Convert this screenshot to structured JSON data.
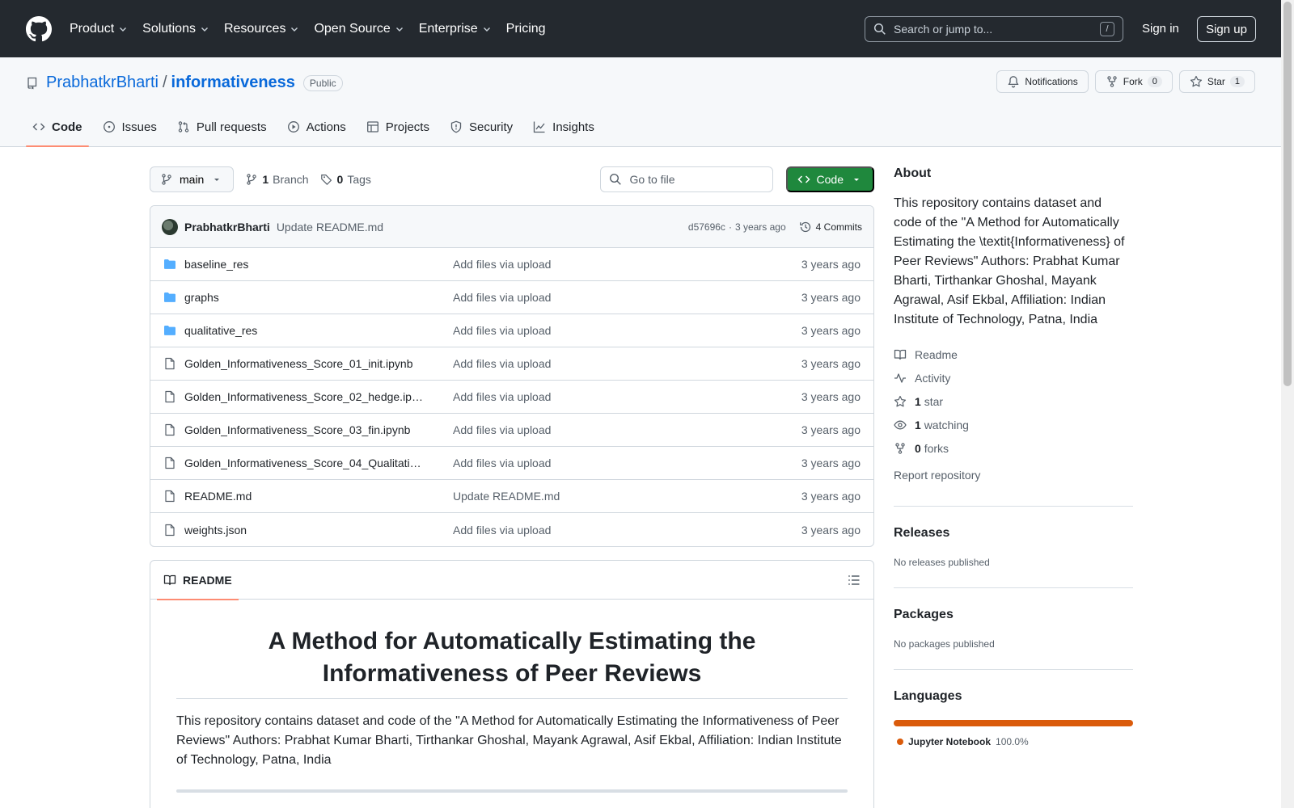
{
  "header": {
    "nav": [
      {
        "label": "Product",
        "dropdown": true
      },
      {
        "label": "Solutions",
        "dropdown": true
      },
      {
        "label": "Resources",
        "dropdown": true
      },
      {
        "label": "Open Source",
        "dropdown": true
      },
      {
        "label": "Enterprise",
        "dropdown": true
      },
      {
        "label": "Pricing",
        "dropdown": false
      }
    ],
    "search_placeholder": "Search or jump to...",
    "search_key": "/",
    "sign_in": "Sign in",
    "sign_up": "Sign up"
  },
  "repo": {
    "owner": "PrabhatkrBharti",
    "separator": "/",
    "name": "informativeness",
    "visibility": "Public",
    "notifications_label": "Notifications",
    "fork_label": "Fork",
    "fork_count": "0",
    "star_label": "Star",
    "star_count": "1"
  },
  "tabs": [
    {
      "label": "Code",
      "icon": "code-icon",
      "active": true
    },
    {
      "label": "Issues",
      "icon": "issue-icon",
      "active": false
    },
    {
      "label": "Pull requests",
      "icon": "pull-request-icon",
      "active": false
    },
    {
      "label": "Actions",
      "icon": "play-icon",
      "active": false
    },
    {
      "label": "Projects",
      "icon": "table-icon",
      "active": false
    },
    {
      "label": "Security",
      "icon": "shield-icon",
      "active": false
    },
    {
      "label": "Insights",
      "icon": "graph-icon",
      "active": false
    }
  ],
  "toolbar": {
    "branch": "main",
    "branch_count": "1",
    "branch_label": "Branch",
    "tag_count": "0",
    "tag_label": "Tags",
    "goto_placeholder": "Go to file",
    "code_label": "Code"
  },
  "latest_commit": {
    "author": "PrabhatkrBharti",
    "message": "Update README.md",
    "hash": "d57696c",
    "dot": "·",
    "age": "3 years ago",
    "commits_label": "4 Commits"
  },
  "files": [
    {
      "name": "baseline_res",
      "type": "folder",
      "commit": "Add files via upload",
      "age": "3 years ago"
    },
    {
      "name": "graphs",
      "type": "folder",
      "commit": "Add files via upload",
      "age": "3 years ago"
    },
    {
      "name": "qualitative_res",
      "type": "folder",
      "commit": "Add files via upload",
      "age": "3 years ago"
    },
    {
      "name": "Golden_Informativeness_Score_01_init.ipynb",
      "type": "file",
      "commit": "Add files via upload",
      "age": "3 years ago"
    },
    {
      "name": "Golden_Informativeness_Score_02_hedge.ip…",
      "type": "file",
      "commit": "Add files via upload",
      "age": "3 years ago"
    },
    {
      "name": "Golden_Informativeness_Score_03_fin.ipynb",
      "type": "file",
      "commit": "Add files via upload",
      "age": "3 years ago"
    },
    {
      "name": "Golden_Informativeness_Score_04_Qualitati…",
      "type": "file",
      "commit": "Add files via upload",
      "age": "3 years ago"
    },
    {
      "name": "README.md",
      "type": "file",
      "commit": "Update README.md",
      "age": "3 years ago"
    },
    {
      "name": "weights.json",
      "type": "file",
      "commit": "Add files via upload",
      "age": "3 years ago"
    }
  ],
  "readme": {
    "tab_label": "README",
    "title": "A Method for Automatically Estimating the Informativeness of Peer Reviews",
    "body": "This repository contains dataset and code of the \"A Method for Automatically Estimating the Informativeness of Peer Reviews\" Authors: Prabhat Kumar Bharti, Tirthankar Ghoshal, Mayank Agrawal, Asif Ekbal, Affiliation: Indian Institute of Technology, Patna, India"
  },
  "about": {
    "heading": "About",
    "description": "This repository contains dataset and code of the \"A Method for Automatically Estimating the \\textit{Informativeness} of Peer Reviews\" Authors: Prabhat Kumar Bharti, Tirthankar Ghoshal, Mayank Agrawal, Asif Ekbal, Affiliation: Indian Institute of Technology, Patna, India",
    "readme": "Readme",
    "activity": "Activity",
    "stars_count": "1",
    "stars_label": "star",
    "watching_count": "1",
    "watching_label": "watching",
    "forks_count": "0",
    "forks_label": "forks",
    "report": "Report repository"
  },
  "releases": {
    "heading": "Releases",
    "text": "No releases published"
  },
  "packages": {
    "heading": "Packages",
    "text": "No packages published"
  },
  "languages": {
    "heading": "Languages",
    "items": [
      {
        "name": "Jupyter Notebook",
        "percent": "100.0%",
        "color": "#DA5B0B"
      }
    ]
  },
  "colors": {
    "header_bg": "#24292f",
    "link": "#0969da",
    "primary_button": "#1f883d",
    "active_tab_underline": "#fd8c73",
    "folder_icon": "#54aeff"
  }
}
